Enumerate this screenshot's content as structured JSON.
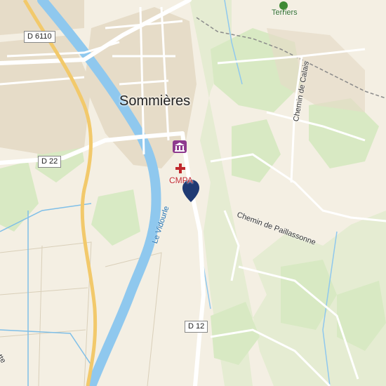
{
  "map": {
    "town_label": "Sommières",
    "road_labels": [
      "D 6110",
      "D 22",
      "D 12"
    ],
    "street_labels": [
      "Chemin de Paillassonne",
      "Chemin de Calais"
    ],
    "river_label": "Le Vidourle",
    "poi_labels": {
      "medical": "CMPA",
      "park": "Terriers"
    },
    "partial_label": "ette",
    "icons": [
      "museum-icon",
      "medical-cross-icon",
      "tree-icon",
      "location-pin-icon"
    ],
    "colors": {
      "land": "#f4efe3",
      "urban": "#e9e1cf",
      "vegetation": "#cfe6b8",
      "water": "#8fc8ee",
      "road_major": "#f2c96b",
      "pin": "#1f3a73",
      "poi_red": "#c0282d",
      "poi_purple": "#8e3a8e"
    }
  }
}
